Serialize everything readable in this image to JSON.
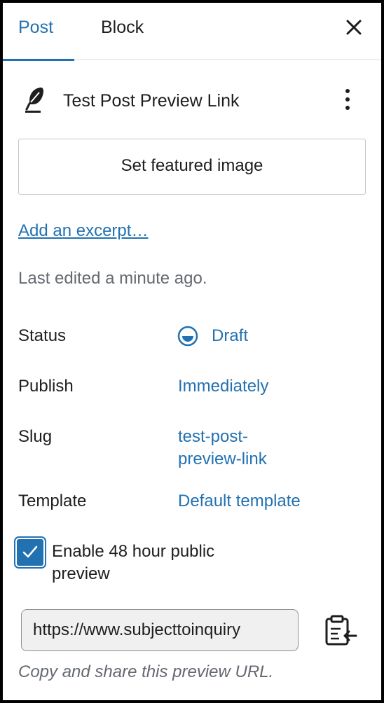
{
  "tabs": [
    {
      "label": "Post",
      "active": true
    },
    {
      "label": "Block",
      "active": false
    }
  ],
  "icons": {
    "close": "close-icon",
    "post_type": "feather-icon",
    "more": "more-vertical-icon",
    "status": "draft-status-icon",
    "checkbox": "checkmark-icon",
    "copy": "clipboard-copy-icon"
  },
  "post": {
    "title": "Test Post Preview Link"
  },
  "featured_image_label": "Set featured image",
  "excerpt_link": "Add an excerpt…",
  "last_edited": "Last edited a minute ago.",
  "summary": [
    {
      "label": "Status",
      "value": "Draft"
    },
    {
      "label": "Publish",
      "value": "Immediately"
    },
    {
      "label": "Slug",
      "value_line1": "test-post-",
      "value_line2": "preview-link"
    },
    {
      "label": "Template",
      "value": "Default template"
    }
  ],
  "preview": {
    "checkbox_checked": true,
    "checkbox_label": "Enable 48 hour public preview",
    "url_value": "https://www.subjecttoinquiry",
    "help_text": "Copy and share this preview URL."
  },
  "colors": {
    "accent": "#2271b1",
    "text": "#1e1e1e",
    "muted": "#646970",
    "border": "#c3c4c7"
  }
}
